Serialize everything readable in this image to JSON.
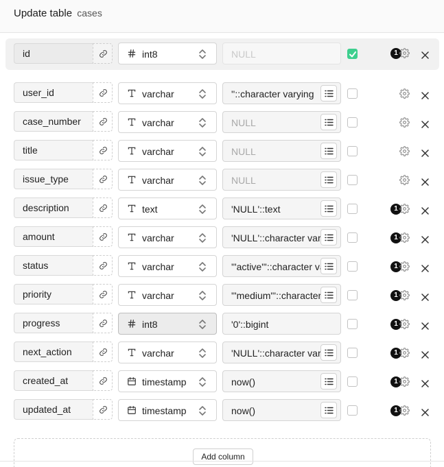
{
  "header": {
    "title": "Update table",
    "table_name": "cases"
  },
  "columns": [
    {
      "name": "id",
      "type": "int8",
      "type_icon": "hash-icon",
      "default": "NULL",
      "default_is_placeholder": true,
      "nullable_checked": true,
      "badge": "1",
      "primary": true
    },
    {
      "name": "user_id",
      "type": "varchar",
      "type_icon": "text-type-icon",
      "default": "''::character varying",
      "default_is_placeholder": false,
      "nullable_checked": false,
      "badge": ""
    },
    {
      "name": "case_number",
      "type": "varchar",
      "type_icon": "text-type-icon",
      "default": "NULL",
      "default_is_placeholder": true,
      "nullable_checked": false,
      "badge": ""
    },
    {
      "name": "title",
      "type": "varchar",
      "type_icon": "text-type-icon",
      "default": "NULL",
      "default_is_placeholder": true,
      "nullable_checked": false,
      "badge": ""
    },
    {
      "name": "issue_type",
      "type": "varchar",
      "type_icon": "text-type-icon",
      "default": "NULL",
      "default_is_placeholder": true,
      "nullable_checked": false,
      "badge": ""
    },
    {
      "name": "description",
      "type": "text",
      "type_icon": "text-type-icon",
      "default": "'NULL'::text",
      "default_is_placeholder": false,
      "nullable_checked": false,
      "badge": "1"
    },
    {
      "name": "amount",
      "type": "varchar",
      "type_icon": "text-type-icon",
      "default": "'NULL'::character varying",
      "default_is_placeholder": false,
      "nullable_checked": false,
      "badge": "1"
    },
    {
      "name": "status",
      "type": "varchar",
      "type_icon": "text-type-icon",
      "default": "'\"active\"'::character varying",
      "default_is_placeholder": false,
      "nullable_checked": false,
      "badge": "1"
    },
    {
      "name": "priority",
      "type": "varchar",
      "type_icon": "text-type-icon",
      "default": "'\"medium\"'::character varying",
      "default_is_placeholder": false,
      "nullable_checked": false,
      "badge": "1"
    },
    {
      "name": "progress",
      "type": "int8",
      "type_icon": "hash-icon",
      "default": "'0'::bigint",
      "default_is_placeholder": false,
      "nullable_checked": false,
      "badge": "1",
      "no_list": true,
      "type_shaded": true
    },
    {
      "name": "next_action",
      "type": "varchar",
      "type_icon": "text-type-icon",
      "default": "'NULL'::character varying",
      "default_is_placeholder": false,
      "nullable_checked": false,
      "badge": "1"
    },
    {
      "name": "created_at",
      "type": "timestamp",
      "type_icon": "calendar-icon",
      "default": "now()",
      "default_is_placeholder": false,
      "nullable_checked": false,
      "badge": "1"
    },
    {
      "name": "updated_at",
      "type": "timestamp",
      "type_icon": "calendar-icon",
      "default": "now()",
      "default_is_placeholder": false,
      "nullable_checked": false,
      "badge": "1"
    }
  ],
  "add_column_label": "Add column",
  "colors": {
    "accent": "#3ecf8e",
    "badge": "#111111"
  }
}
